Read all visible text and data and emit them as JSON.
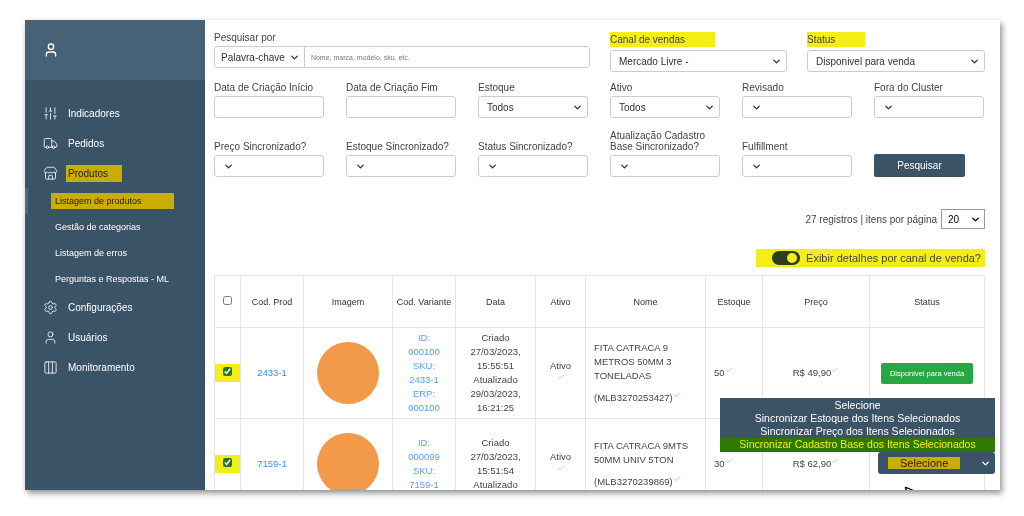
{
  "sidebar": {
    "items": [
      {
        "label": "Indicadores",
        "highlighted": false
      },
      {
        "label": "Pedidos",
        "highlighted": false
      },
      {
        "label": "Produtos",
        "highlighted": true,
        "children": [
          {
            "label": "Listagem de produtos",
            "selected": true,
            "highlighted": true
          },
          {
            "label": "Gestão de categorias",
            "selected": false,
            "highlighted": false
          },
          {
            "label": "Listagem de erros",
            "selected": false,
            "highlighted": false
          },
          {
            "label": "Perguntas e Respostas - ML",
            "selected": false,
            "highlighted": false
          }
        ]
      },
      {
        "label": "Configurações",
        "highlighted": false
      },
      {
        "label": "Usuários",
        "highlighted": false
      },
      {
        "label": "Monitoramento",
        "highlighted": false
      }
    ]
  },
  "top_filters": [
    {
      "kind": "search",
      "label": "Pesquisar por",
      "value": "Palavra-chave",
      "placeholder": "Nome, marca, modelo, sku, etc.",
      "highlighted": false
    },
    {
      "kind": "select",
      "label": "Canal de vendas",
      "value": "Mercado Livre -",
      "highlighted": true
    },
    {
      "kind": "select",
      "label": "Status",
      "value": "Disponivel para venda",
      "highlighted": true
    }
  ],
  "filters": [
    {
      "kind": "input",
      "label": "Data de Criação Início"
    },
    {
      "kind": "input",
      "label": "Data de Criação Fim"
    },
    {
      "kind": "select",
      "label": "Estoque",
      "value": "Todos"
    },
    {
      "kind": "select",
      "label": "Ativo",
      "value": "Todos"
    },
    {
      "kind": "select",
      "label": "Revisado"
    },
    {
      "kind": "select",
      "label": "Fora do Cluster"
    },
    {
      "kind": "select",
      "label": "Preço Sincronizado?"
    },
    {
      "kind": "select",
      "label": "Estoque Sincronizado?"
    },
    {
      "kind": "select",
      "label": "Status Sincronizado?"
    },
    {
      "kind": "select",
      "label": "Atualização Cadastro Base Sincronizado?"
    },
    {
      "kind": "select",
      "label": "Fulfillment"
    },
    {
      "kind": "button",
      "label": "Pesquisar"
    }
  ],
  "pagination": {
    "summary": "27 registros | itens por página",
    "per_page": "20"
  },
  "details_toggle": {
    "label": "Exibir detalhes por canal de venda?",
    "on": true,
    "highlighted": true
  },
  "table": {
    "select_all": {
      "checked": false
    },
    "columns": [
      "Cod. Prod",
      "Imagem",
      "Cod. Variante",
      "Data",
      "Ativo",
      "Nome",
      "Estoque",
      "Preço",
      "Status"
    ],
    "rows": [
      {
        "selected": true,
        "highlighted": true,
        "cod_prod": "2433-1",
        "variant": [
          "ID:",
          "000100",
          "SKU:",
          "2433-1",
          "ERP:",
          "000100"
        ],
        "date": [
          "Criado",
          "27/03/2023,",
          "15:55:51",
          "Atualizado",
          "29/03/2023,",
          "16:21:25"
        ],
        "ativo": "Ativo",
        "nome": "FITA CATRACA 9 METROS 50MM 3 TONELADAS",
        "mlb": "(MLB3270253427)",
        "estoque": "50",
        "preco": "R$ 49,90",
        "status": "Disponivel para venda"
      },
      {
        "selected": true,
        "highlighted": true,
        "cod_prod": "7159-1",
        "variant": [
          "ID:",
          "000099",
          "SKU:",
          "7159-1"
        ],
        "date": [
          "Criado",
          "27/03/2023,",
          "15:51:54",
          "Atualizado"
        ],
        "ativo": "Ativo",
        "nome": "FITA CATRACA 9MTS 50MM UNIV 5TON",
        "mlb": "(MLB3270239869)",
        "estoque": "30",
        "preco": "R$ 62,90"
      }
    ]
  },
  "bulk_action": {
    "options": [
      {
        "label": "Selecione",
        "highlighted": false
      },
      {
        "label": "Sincronizar Estoque dos Itens Selecionados",
        "highlighted": false
      },
      {
        "label": "Sincronizar Preço dos Itens Selecionados",
        "highlighted": false
      },
      {
        "label": "Sincronizar Cadastro Base dos Itens Selecionados",
        "highlighted": true
      }
    ],
    "value": "Selecione",
    "highlighted": true
  }
}
